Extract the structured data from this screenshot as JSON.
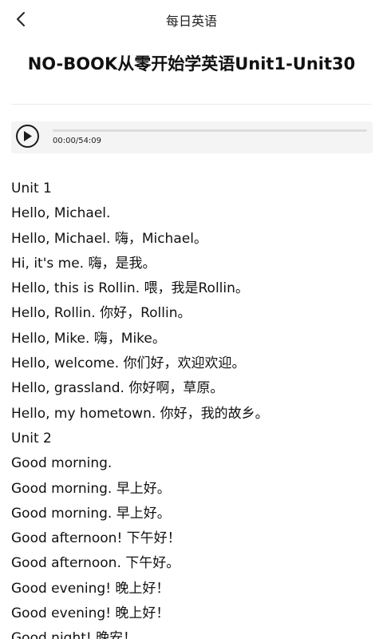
{
  "nav": {
    "back_icon": "chevron-left-icon",
    "title": "每日英语"
  },
  "article": {
    "title": "NO-BOOK从零开始学英语Unit1-Unit30"
  },
  "player": {
    "play_icon": "play-circle-icon",
    "progress": 0,
    "current_time": "00:00",
    "separator": "/",
    "duration": "54:09"
  },
  "content": {
    "lines": [
      "Unit 1",
      "Hello, Michael.",
      "Hello, Michael.   嗨，Michael。",
      "Hi, it's me.   嗨，是我。",
      "Hello, this is Rollin.   喂，我是Rollin。",
      "Hello, Rollin.   你好，Rollin。",
      "Hello, Mike.   嗨，Mike。",
      "Hello, welcome.   你们好，欢迎欢迎。",
      "Hello, grassland.   你好啊，草原。",
      "Hello, my hometown.   你好，我的故乡。",
      "Unit 2",
      "Good morning.",
      "Good morning.   早上好。",
      "Good morning.   早上好。",
      "Good afternoon!   下午好！",
      "Good afternoon.   下午好。",
      "Good evening!   晚上好！",
      "Good evening!   晚上好！",
      "Good night!   晚安！"
    ]
  },
  "colors": {
    "text": "#111111",
    "player_bg": "#f4f4f5",
    "track": "#dcdcdc"
  }
}
